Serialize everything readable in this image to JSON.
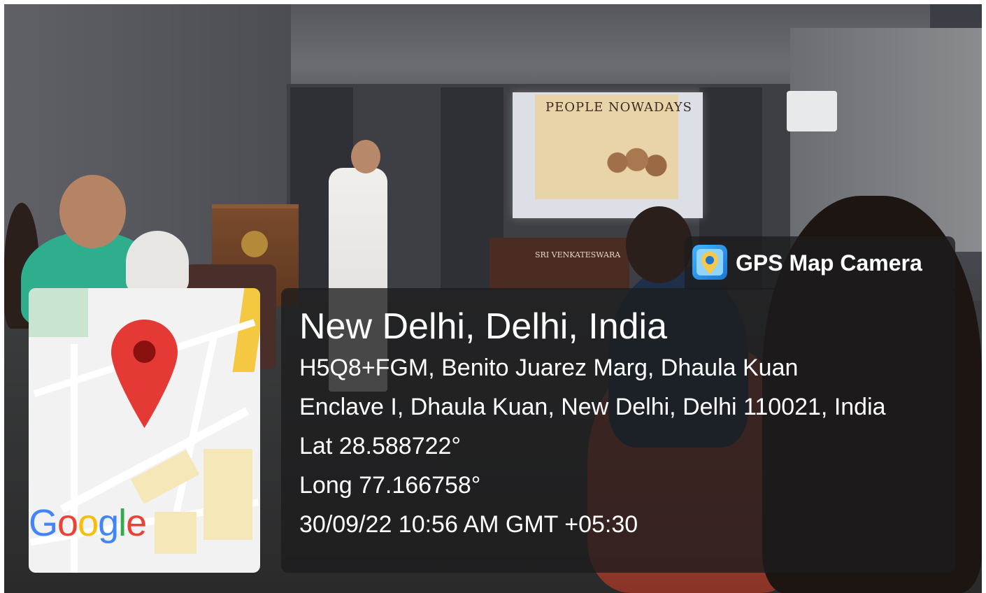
{
  "overlay": {
    "app_name": "GPS Map Camera",
    "location_title": "New Delhi, Delhi, India",
    "address_line1": "H5Q8+FGM, Benito Juarez Marg, Dhaula Kuan",
    "address_line2": "Enclave I, Dhaula Kuan, New Delhi, Delhi 110021, India",
    "latitude": "Lat 28.588722°",
    "longitude": "Long 77.166758°",
    "datetime": "30/09/22 10:56 AM GMT +05:30"
  },
  "map": {
    "logo_text": "Google",
    "logo_colors": [
      "#4285F4",
      "#EA4335",
      "#FBBC05",
      "#4285F4",
      "#34A853",
      "#EA4335"
    ],
    "pin_color": "#E53935",
    "pin_icon": "map-pin-icon"
  },
  "scene": {
    "slide_text": "PEOPLE NOWADAYS",
    "desk_sign": "SRI VENKATESWARA"
  }
}
